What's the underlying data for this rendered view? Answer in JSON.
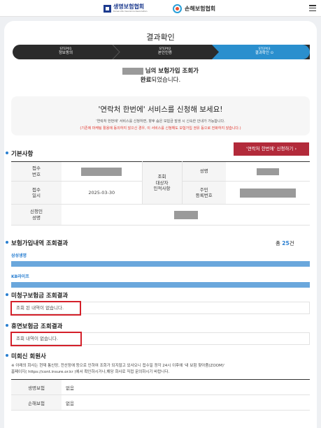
{
  "header": {
    "logo_life": "생명보험협회",
    "logo_life_en": "Korea Life Insurance Association",
    "logo_nonlife": "손해보험협회",
    "menu_icon": "hamburger-menu-icon"
  },
  "page": {
    "title": "결과확인"
  },
  "steps": [
    {
      "num": "STEP01",
      "label": "정보동의"
    },
    {
      "num": "STEP02",
      "label": "본인인증"
    },
    {
      "num": "STEP03",
      "label": "결과확인 ⊙"
    }
  ],
  "result_msg": {
    "line1_suffix": "님의 보험가입 조회가",
    "line2_bold": "완료",
    "line2_rest": "되었습니다."
  },
  "promo": {
    "headline": "'연락처 한번에' 서비스를 신청해 보세요!",
    "desc": "'연락처 한번에' 서비스를 신청하면, 향후 숨은 보험금 발생 시 신속한 안내가 가능합니다.",
    "warning": "(기존에 마케팅 활용에 동의하지 않으신 경우, 이 서비스를 신청해도 보험가입 권유 등으로 전화하지 않습니다.)"
  },
  "basic": {
    "title": "기본사항",
    "apply_button": "'연락처 한번에' 신청하기   ›",
    "receipt_no_label": "접수\n번호",
    "receipt_date_label": "접수\n일시",
    "receipt_date": "2025-03-30",
    "applicant_label": "신청인\n성명",
    "target_label": "조회\n대상자\n인적사항",
    "name_label": "성명",
    "rrn_label": "주민\n등록번호"
  },
  "insurance": {
    "title": "보험가입내역 조회결과",
    "total_prefix": "총 ",
    "total_count": "25",
    "total_suffix": "건",
    "companies": [
      "삼성생명",
      "KB라이프"
    ]
  },
  "unclaimed": {
    "title": "미청구보험금 조회결과",
    "message": "조회 된 내역이 없습니다."
  },
  "dormant": {
    "title": "휴면보험금 조회결과",
    "message": "조회 내역이 없습니다."
  },
  "nonmember": {
    "title": "미회신 회원사",
    "note_line1": "※ 아래의 회사는 현재 통신망, 전산장애 등으로 인하여 조회가 되지않고 있사오니 접수일 정각 24시 이후에    '내 보험 찾아줌(ZOOM)'",
    "note_line2": "홈페이지( https://cont.insure.or.kr )에서 확인하시거나,해당 회사로 직접 문의하시기 바랍니다.",
    "rows": [
      {
        "company": "생명보험",
        "value": "없음"
      },
      {
        "company": "손해보험",
        "value": "없음"
      }
    ]
  },
  "colors": {
    "accent": "#2a7fd1",
    "step_active": "#2a8fce",
    "step_dark": "#2b2b2b",
    "button_red": "#b22a3a",
    "highlight_red": "#d4202a"
  }
}
